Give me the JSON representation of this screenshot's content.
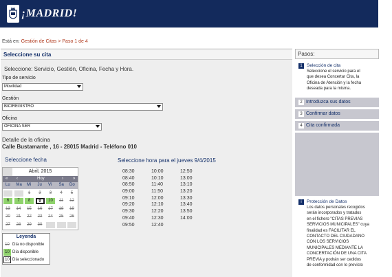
{
  "header": {
    "logo_text": "¡MADRID!",
    "logo_icon": "madrid-crest-icon",
    "background": "#132a5c"
  },
  "breadcrumb": {
    "prefix": "Está en:",
    "link1": "Gestión de Citas",
    "separator": ">",
    "current": "Paso 1 de 4"
  },
  "section_title": "Seleccione su cita",
  "subtitle": "Seleccione: Servicio, Gestión, Oficina, Fecha y Hora.",
  "form": {
    "tipo_label": "Tipo de servicio",
    "tipo_value": "Movilidad",
    "gestion_label": "Gestión",
    "gestion_value": "BICIREGISTRO",
    "oficina_label": "Oficina",
    "oficina_value": "OFICINA SER"
  },
  "detail": {
    "label": "Detalle de la oficina",
    "address": "Calle Bustamante , 16 - 28015 Madrid - Teléfono 010"
  },
  "fecha_title": "Seleccione fecha",
  "hora_title": "Seleccione hora para el jueves 9/4/2015",
  "calendar": {
    "month": "Abril, 2015",
    "nav": {
      "prev_prev": "«",
      "prev": "‹",
      "today": "Hoy",
      "next": "›",
      "next_next": "»"
    },
    "weekdays": [
      "Lu",
      "Ma",
      "Mi",
      "Ju",
      "Vi",
      "Sa",
      "Do"
    ],
    "weeks": [
      [
        "",
        "",
        "1",
        "2",
        "3",
        "4",
        "5"
      ],
      [
        "6",
        "7",
        "8",
        "9",
        "10",
        "11",
        "12"
      ],
      [
        "13",
        "14",
        "15",
        "16",
        "17",
        "18",
        "19"
      ],
      [
        "20",
        "21",
        "22",
        "23",
        "24",
        "25",
        "26"
      ],
      [
        "27",
        "28",
        "29",
        "30",
        "",
        "",
        ""
      ]
    ],
    "available": [
      "6",
      "7",
      "8",
      "10"
    ],
    "selected": "9",
    "colors": {
      "available": "#8fd36c",
      "header": "#b8b8c2",
      "nav": "#7a7a8a"
    }
  },
  "legend": {
    "title": "Leyenda",
    "items": [
      {
        "num": "10",
        "label": "Día no disponible"
      },
      {
        "num": "10",
        "label": "Día disponible"
      },
      {
        "num": "10",
        "label": "Día seleccionado"
      }
    ]
  },
  "times": [
    [
      "08:30",
      "08:40",
      "08:50",
      "09:00",
      "09:10",
      "09:20",
      "09:30",
      "09:40",
      "09:50"
    ],
    [
      "10:00",
      "10:10",
      "11:40",
      "11:50",
      "12:00",
      "12:10",
      "12:20",
      "12:30",
      "12:40"
    ],
    [
      "12:50",
      "13:00",
      "13:10",
      "13:20",
      "13:30",
      "13:40",
      "13:50",
      "14:00"
    ]
  ],
  "steps": {
    "title": "Pasos:",
    "active": {
      "num": "1",
      "heading": "Selección de cita",
      "lines": [
        "Seleccione el servicio para el",
        "que desea Concertar Cita, la",
        "Oficina de Atención y la fecha",
        "deseada para la misma."
      ]
    },
    "items": [
      {
        "num": "2",
        "label": "Introduzca sus datos"
      },
      {
        "num": "3",
        "label": "Confirmar datos"
      },
      {
        "num": "4",
        "label": "Cita confirmada"
      }
    ],
    "protection": {
      "num": "i",
      "heading": "Protección de Datos",
      "lines": [
        "Los datos personales recogidos",
        "serán incorporados y tratados",
        "en el fichero \"CITAS PREVIAS",
        "SERVICIOS MUNICIPALES\" cuya",
        "finalidad es FACILITAR EL",
        "CONTACTO DEL CIUDADANO",
        "CON LOS SERVICIOS",
        "MUNICIPALES MEDIANTE LA",
        "CONCERTACIÓN DE UNA CITA",
        "PREVIA y podrán ser cedidos",
        "de conformidad con lo previsto"
      ]
    }
  }
}
